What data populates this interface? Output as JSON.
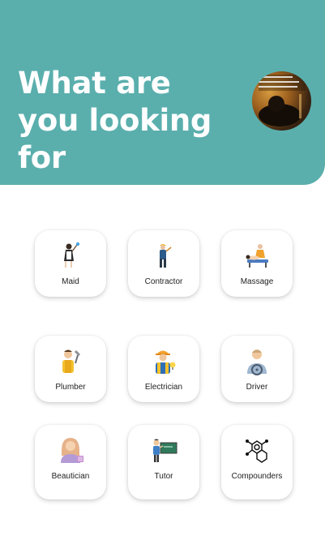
{
  "header": {
    "title": "What are you looking for",
    "bg_color": "#5aafad",
    "avatar_icon": "profile-photo"
  },
  "services": [
    {
      "label": "Maid",
      "icon": "maid-icon"
    },
    {
      "label": "Contractor",
      "icon": "contractor-icon"
    },
    {
      "label": "Massage",
      "icon": "massage-icon"
    },
    {
      "label": "Plumber",
      "icon": "plumber-icon"
    },
    {
      "label": "Electrician",
      "icon": "electrician-icon"
    },
    {
      "label": "Driver",
      "icon": "driver-icon"
    },
    {
      "label": "Beautician",
      "icon": "beautician-icon"
    },
    {
      "label": "Tutor",
      "icon": "tutor-icon"
    },
    {
      "label": "Compounders",
      "icon": "compounders-icon"
    }
  ]
}
